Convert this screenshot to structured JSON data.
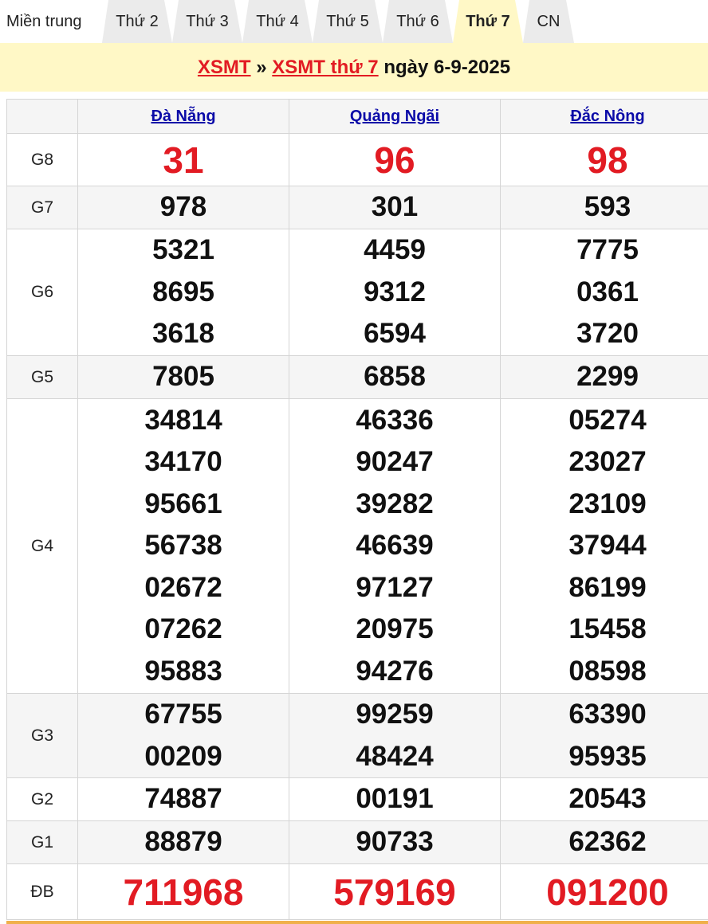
{
  "tabs": [
    {
      "label": "Miền trung",
      "active": false
    },
    {
      "label": "Thứ 2",
      "active": false
    },
    {
      "label": "Thứ 3",
      "active": false
    },
    {
      "label": "Thứ 4",
      "active": false
    },
    {
      "label": "Thứ 5",
      "active": false
    },
    {
      "label": "Thứ 6",
      "active": false
    },
    {
      "label": "Thứ 7",
      "active": true
    },
    {
      "label": "CN",
      "active": false
    }
  ],
  "breadcrumb": {
    "link1": "XSMT",
    "separator": "»",
    "link2": "XSMT thứ 7",
    "date_text": "ngày 6-9-2025"
  },
  "provinces": [
    "Đà Nẵng",
    "Quảng Ngãi",
    "Đắc Nông"
  ],
  "prizes": {
    "g8": {
      "label": "G8",
      "values": [
        [
          "31"
        ],
        [
          "96"
        ],
        [
          "98"
        ]
      ]
    },
    "g7": {
      "label": "G7",
      "values": [
        [
          "978"
        ],
        [
          "301"
        ],
        [
          "593"
        ]
      ]
    },
    "g6": {
      "label": "G6",
      "values": [
        [
          "5321",
          "8695",
          "3618"
        ],
        [
          "4459",
          "9312",
          "6594"
        ],
        [
          "7775",
          "0361",
          "3720"
        ]
      ]
    },
    "g5": {
      "label": "G5",
      "values": [
        [
          "7805"
        ],
        [
          "6858"
        ],
        [
          "2299"
        ]
      ]
    },
    "g4": {
      "label": "G4",
      "values": [
        [
          "34814",
          "34170",
          "95661",
          "56738",
          "02672",
          "07262",
          "95883"
        ],
        [
          "46336",
          "90247",
          "39282",
          "46639",
          "97127",
          "20975",
          "94276"
        ],
        [
          "05274",
          "23027",
          "23109",
          "37944",
          "86199",
          "15458",
          "08598"
        ]
      ]
    },
    "g3": {
      "label": "G3",
      "values": [
        [
          "67755",
          "00209"
        ],
        [
          "99259",
          "48424"
        ],
        [
          "63390",
          "95935"
        ]
      ]
    },
    "g2": {
      "label": "G2",
      "values": [
        [
          "74887"
        ],
        [
          "00191"
        ],
        [
          "20543"
        ]
      ]
    },
    "g1": {
      "label": "G1",
      "values": [
        [
          "88879"
        ],
        [
          "90733"
        ],
        [
          "62362"
        ]
      ]
    },
    "db": {
      "label": "ĐB",
      "values": [
        [
          "711968"
        ],
        [
          "579169"
        ],
        [
          "091200"
        ]
      ]
    }
  },
  "colors": {
    "accent_red": "#e21b23",
    "link_blue": "#0b0ba8",
    "banner_yellow": "#fff8c6"
  }
}
